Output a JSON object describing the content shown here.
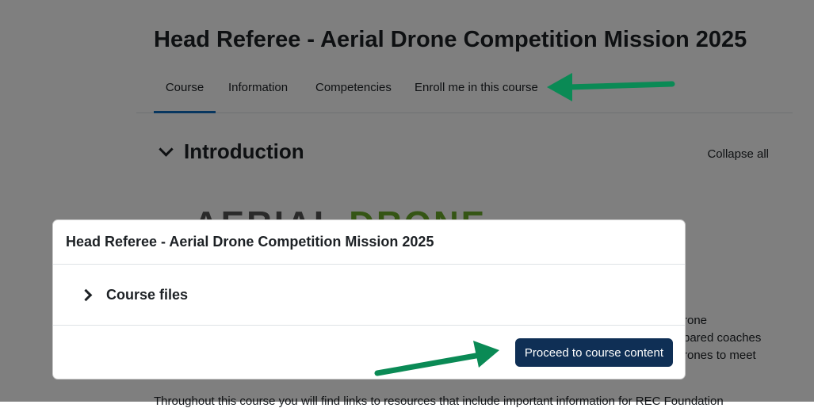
{
  "course": {
    "title": "Head Referee - Aerial Drone Competition Mission 2025"
  },
  "tabs": [
    {
      "label": "Course"
    },
    {
      "label": "Information"
    },
    {
      "label": "Competencies"
    },
    {
      "label": "Enroll me in this course"
    }
  ],
  "section": {
    "title": "Introduction",
    "collapse_all": "Collapse all"
  },
  "logo": {
    "part1": "AERIAL",
    "part2": "DRONE"
  },
  "background_text": {
    "line1": "rone",
    "line2": "pared coaches",
    "line3": "rones to meet",
    "line4": "Throughout this course you will find links to resources that include important information for REC Foundation"
  },
  "modal": {
    "title": "Head Referee - Aerial Drone Competition Mission 2025",
    "files_label": "Course files",
    "proceed_label": "Proceed to course content"
  },
  "colors": {
    "arrow": "#0a8a55",
    "button": "#0f2f55",
    "active_tab": "#0f6cbf"
  }
}
